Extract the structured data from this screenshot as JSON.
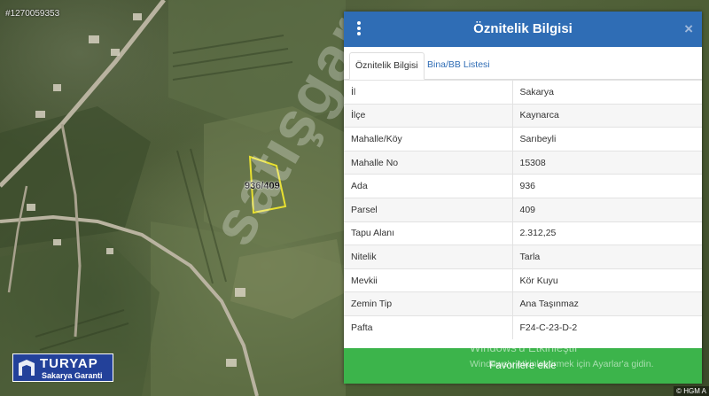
{
  "map": {
    "listing_id": "#1270059353",
    "parcel_label": "936/409",
    "watermark": "satışgar",
    "attribution": "© HGM A"
  },
  "logo": {
    "name": "TURYAP",
    "subtitle": "Sakarya Garanti"
  },
  "panel": {
    "title": "Öznitelik Bilgisi",
    "close": "×",
    "tabs": [
      {
        "label": "Öznitelik Bilgisi",
        "active": true
      },
      {
        "label": "Bina/BB Listesi",
        "active": false
      }
    ],
    "rows": [
      {
        "key": "İl",
        "value": "Sakarya"
      },
      {
        "key": "İlçe",
        "value": "Kaynarca"
      },
      {
        "key": "Mahalle/Köy",
        "value": "Sarıbeyli"
      },
      {
        "key": "Mahalle No",
        "value": "15308"
      },
      {
        "key": "Ada",
        "value": "936"
      },
      {
        "key": "Parsel",
        "value": "409"
      },
      {
        "key": "Tapu Alanı",
        "value": "2.312,25"
      },
      {
        "key": "Nitelik",
        "value": "Tarla"
      },
      {
        "key": "Mevkii",
        "value": "Kör Kuyu"
      },
      {
        "key": "Zemin Tip",
        "value": "Ana Taşınmaz"
      },
      {
        "key": "Pafta",
        "value": "F24-C-23-D-2"
      }
    ],
    "favorite_button": "Favorilere ekle"
  },
  "windows_notice": {
    "title": "Windows'u Etkinleştir",
    "subtitle": "Windows'u etkinleştirmek için Ayarlar'a gidin."
  },
  "colors": {
    "header_blue": "#2f6db5",
    "favorite_green": "#3cb44b",
    "parcel_outline": "#e8e030",
    "logo_blue": "#23419a"
  }
}
